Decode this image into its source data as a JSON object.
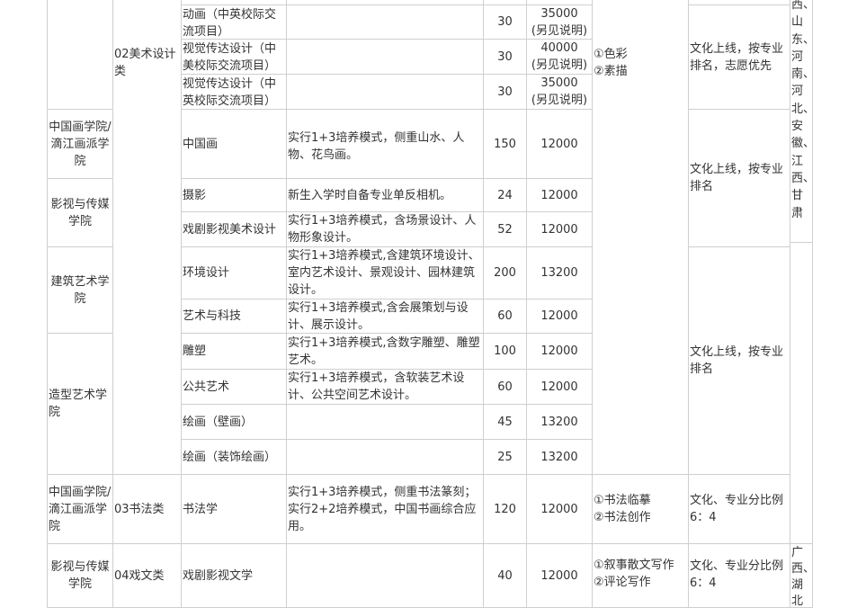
{
  "truncated_top_text": "...",
  "rows": [
    {
      "major": "动画（中英校际交流项目）",
      "quota": "30",
      "fee": "35000",
      "fee_note": "(另见说明)"
    },
    {
      "major": "视觉传达设计（中美校际交流项目）",
      "quota": "30",
      "fee": "40000",
      "fee_note": "(另见说明)"
    },
    {
      "major": "视觉传达设计（中英校际交流项目）",
      "quota": "30",
      "fee": "35000",
      "fee_note": "(另见说明)"
    },
    {
      "major": "中国画",
      "desc": "实行1+3培养模式，侧重山水、人物、花鸟画。",
      "quota": "150",
      "fee": "12000"
    },
    {
      "major": "摄影",
      "desc": "新生入学时自备专业单反相机。",
      "quota": "24",
      "fee": "12000"
    },
    {
      "major": "戏剧影视美术设计",
      "desc": "实行1+3培养模式，含场景设计、人物形象设计。",
      "quota": "52",
      "fee": "12000"
    },
    {
      "major": "环境设计",
      "desc": "实行1+3培养模式,含建筑环境设计、室内艺术设计、景观设计、园林建筑设计。",
      "quota": "200",
      "fee": "13200"
    },
    {
      "major": "艺术与科技",
      "desc": "实行1+3培养模式,含会展策划与设计、展示设计。",
      "quota": "60",
      "fee": "12000"
    },
    {
      "major": "雕塑",
      "desc": "实行1+3培养模式,含数字雕塑、雕塑艺术。",
      "quota": "100",
      "fee": "12000"
    },
    {
      "major": "公共艺术",
      "desc": "实行1+3培养模式，含软装艺术设计、公共空间艺术设计。",
      "quota": "60",
      "fee": "12000"
    },
    {
      "major": "绘画（壁画）",
      "quota": "45",
      "fee": "13200"
    },
    {
      "major": "绘画（装饰绘画）",
      "quota": "25",
      "fee": "13200"
    },
    {
      "major": "书法学",
      "desc": "实行1+3培养模式，侧重书法篆刻；实行2+2培养模式，中国书画综合应用。",
      "quota": "120",
      "fee": "12000"
    },
    {
      "major": "戏剧影视文学",
      "quota": "40",
      "fee": "12000"
    }
  ],
  "colleges": {
    "guohua1": "中国画学院/滴江画派学院",
    "yingshi1": "影视与传媒学院",
    "jianzhu": "建筑艺术学院",
    "zaoxing": "造型艺术学院",
    "guohua2": "中国画学院/滴江画派学院",
    "yingshi2": "影视与传媒学院"
  },
  "categories": {
    "meishu": "02美术设计类",
    "shufa": "03书法类",
    "xiwen": "04戏文类"
  },
  "subjects": {
    "meishu": [
      "①色彩",
      "②素描"
    ],
    "shufa": [
      "①书法临摹",
      "②书法创作"
    ],
    "xiwen": [
      "①叙事散文写作",
      "②评论写作"
    ]
  },
  "rules": {
    "r1": "文化上线，按专业排名，志愿优先",
    "r2": "文化上线，按专业排名",
    "r3": "文化上线，按专业排名",
    "r4": "文化、专业分比例6：4",
    "r5": "文化、专业分比例6：4"
  },
  "regions": {
    "top": [
      "西、",
      "山",
      "东、",
      "河",
      "南、",
      "河",
      "北、",
      "安",
      "徽、",
      "江",
      "西、",
      "甘",
      "肃"
    ],
    "bottom": [
      "广",
      "西、",
      "湖",
      "北"
    ]
  }
}
